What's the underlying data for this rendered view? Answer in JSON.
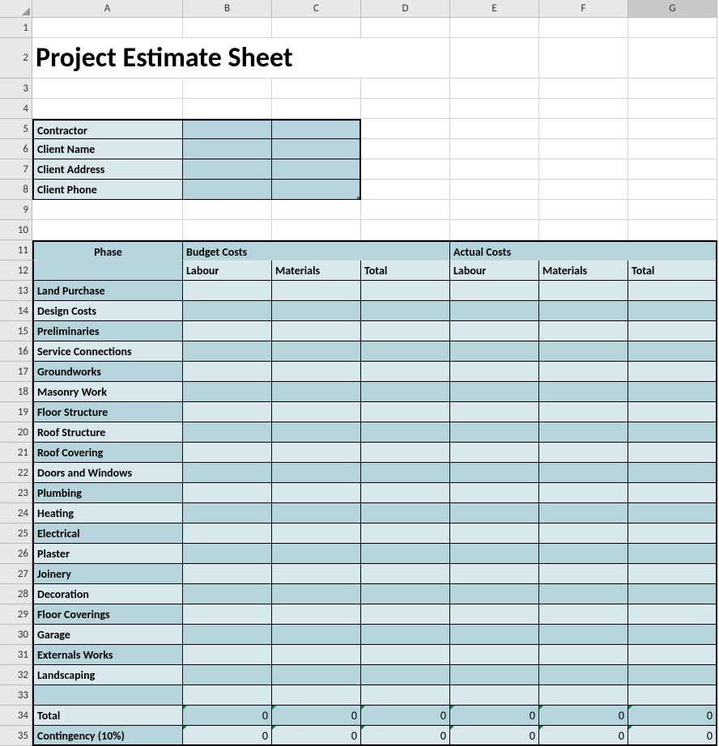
{
  "columns": [
    "A",
    "B",
    "C",
    "D",
    "E",
    "F",
    "G"
  ],
  "selected_column": "G",
  "title": "Project Estimate Sheet",
  "client_info": {
    "rows": [
      "Contractor",
      "Client Name",
      "Client Address",
      "Client Phone"
    ]
  },
  "headers": {
    "phase": "Phase",
    "budget": "Budget Costs",
    "actual": "Actual Costs",
    "labour": "Labour",
    "materials": "Materials",
    "total": "Total"
  },
  "phases": [
    "Land Purchase",
    "Design Costs",
    "Preliminaries",
    "Service Connections",
    "Groundworks",
    "Masonry Work",
    "Floor Structure",
    "Roof Structure",
    "Roof Covering",
    "Doors and Windows",
    "Plumbing",
    "Heating",
    "Electrical",
    "Plaster",
    "Joinery",
    "Decoration",
    "Floor Coverings",
    "Garage",
    "Externals Works",
    "Landscaping"
  ],
  "summary": {
    "total_label": "Total",
    "contingency_label": "Contingency (10%)",
    "zero": "0"
  },
  "row_numbers": {
    "title": "2",
    "info_start": 5,
    "header1": 11,
    "header2": 12,
    "phase_start": 13,
    "blank_row": 33,
    "total_row": 34,
    "cont_row": 35
  }
}
